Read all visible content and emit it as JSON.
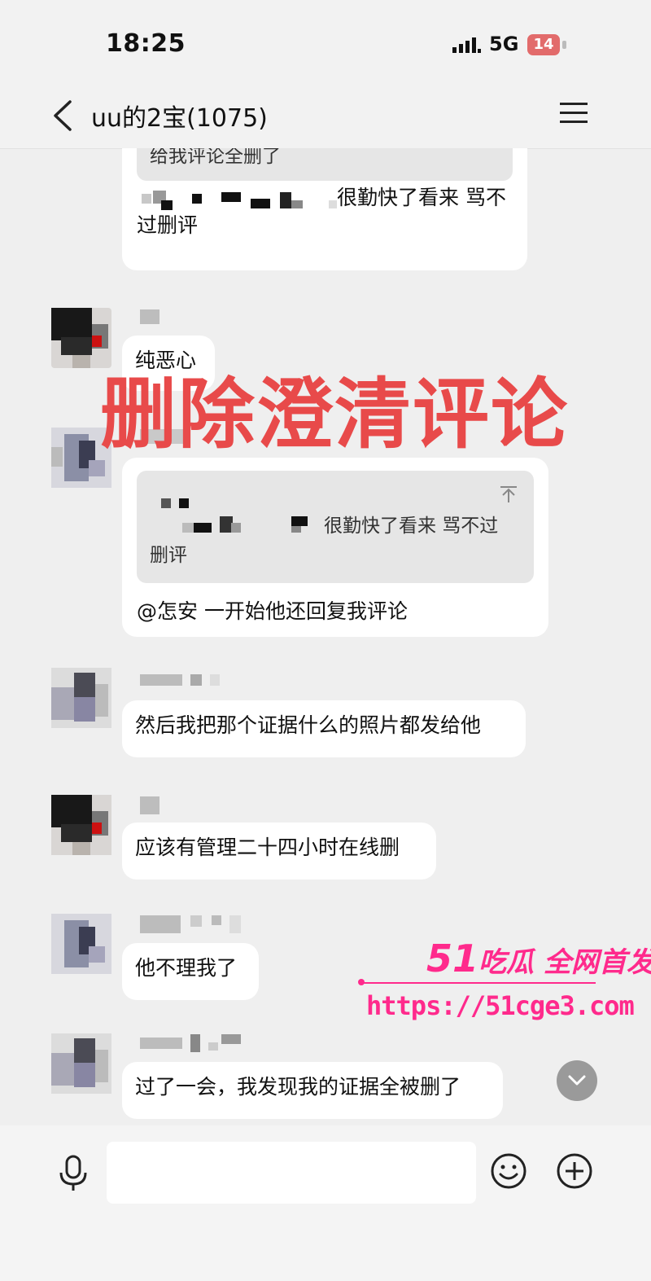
{
  "status_bar": {
    "time": "18:25",
    "network": "5G",
    "battery": "14"
  },
  "header": {
    "title": "uu的2宝(1075)",
    "back_icon": "chevron-left-icon",
    "menu_icon": "hamburger-menu-icon"
  },
  "messages": [
    {
      "quote": "给我评论全删了",
      "text_line1": "很勤快了看来 骂不",
      "text_line2": "过删评"
    },
    {
      "text": "纯恶心"
    },
    {
      "quote_line1": "很勤快了看来 骂不过",
      "quote_line2": "删评",
      "text": "@怎安 一开始他还回复我评论"
    },
    {
      "text": "然后我把那个证据什么的照片都发给他"
    },
    {
      "text": "应该有管理二十四小时在线删"
    },
    {
      "text": "他不理我了"
    },
    {
      "text": "过了一会，我发现我的证据全被删了"
    }
  ],
  "overlay_caption": "删除澄清评论",
  "watermark": {
    "brand_number": "51",
    "brand_text": "吃瓜 全网首发",
    "url": "https://51cge3.com"
  },
  "composer": {
    "input_value": "",
    "mic_icon": "microphone-icon",
    "emoji_icon": "smiley-icon",
    "plus_icon": "plus-circle-icon",
    "scroll_icon": "chevron-down-icon"
  },
  "colors": {
    "overlay": "#e84a4a",
    "watermark": "#ff2a8c",
    "battery": "#e26b6b",
    "background": "#efefef"
  }
}
